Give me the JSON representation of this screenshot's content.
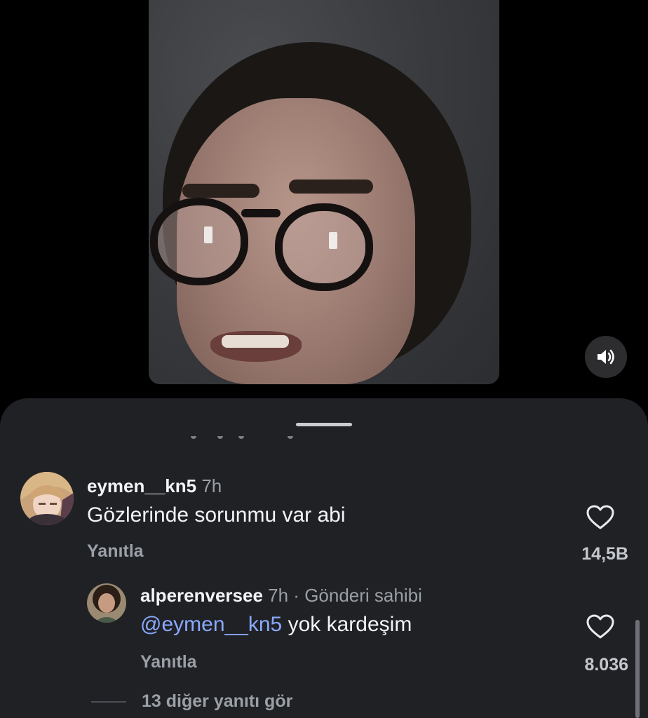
{
  "comments": [
    {
      "username": "eymen__kn5",
      "time": "7h",
      "text": "Gözlerinde sorunmu var abi",
      "reply_label": "Yanıtla",
      "likes": "14,5B"
    }
  ],
  "reply": {
    "username": "alperenversee",
    "time": "7h",
    "separator": "·",
    "badge": "Gönderi sahibi",
    "mention": "@eymen__kn5",
    "text": " yok kardeşim",
    "reply_label": "Yanıtla",
    "likes": "8.036"
  },
  "more_replies": "13 diğer yanıtı gör",
  "icons": {
    "mute": "speaker-icon",
    "like": "heart-icon"
  },
  "colors": {
    "sheet_bg": "#1f2125",
    "mention": "#8aa9ff",
    "secondary_text": "#9aa0a6"
  }
}
